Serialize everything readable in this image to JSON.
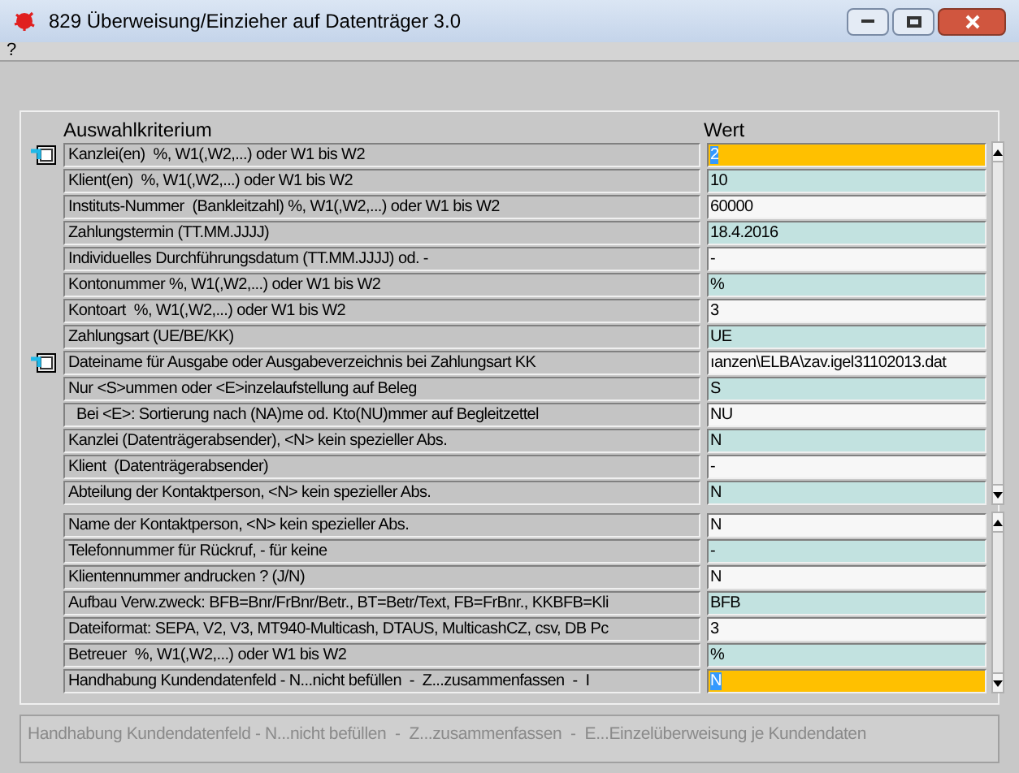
{
  "window": {
    "title": "829 Überweisung/Einzieher auf Datenträger 3.0"
  },
  "menu": [
    "?"
  ],
  "columns": [
    "Auswahlkriterium",
    "Wert"
  ],
  "sections": [
    {
      "rows": [
        {
          "label": "Kanzlei(en)  %, W1(,W2,...) oder W1 bis W2",
          "value": "2",
          "lookup": true,
          "focused": true
        },
        {
          "label": "Klient(en)  %, W1(,W2,...) oder W1 bis W2",
          "value": "10",
          "lookup": false,
          "focused": false
        },
        {
          "label": "Instituts-Nummer  (Bankleitzahl) %, W1(,W2,...) oder W1 bis W2",
          "value": "60000",
          "lookup": false,
          "focused": false
        },
        {
          "label": "Zahlungstermin (TT.MM.JJJJ)",
          "value": "18.4.2016",
          "lookup": false,
          "focused": false
        },
        {
          "label": "Individuelles Durchführungsdatum (TT.MM.JJJJ) od. -",
          "value": "-",
          "lookup": false,
          "focused": false
        },
        {
          "label": "Kontonummer %, W1(,W2,...) oder W1 bis W2",
          "value": "%",
          "lookup": false,
          "focused": false
        },
        {
          "label": "Kontoart  %, W1(,W2,...) oder W1 bis W2",
          "value": "3",
          "lookup": false,
          "focused": false
        },
        {
          "label": "Zahlungsart (UE/BE/KK)",
          "value": "UE",
          "lookup": false,
          "focused": false
        },
        {
          "label": "Dateiname für Ausgabe oder Ausgabeverzeichnis bei Zahlungsart KK",
          "value": "ıanzen\\ELBA\\zav.igel31102013.dat",
          "lookup": true,
          "focused": false
        },
        {
          "label": "Nur <S>ummen oder <E>inzelaufstellung auf Beleg",
          "value": "S",
          "lookup": false,
          "focused": false
        },
        {
          "label": "  Bei <E>: Sortierung nach (NA)me od. Kto(NU)mmer auf Begleitzettel",
          "value": "NU",
          "lookup": false,
          "focused": false
        },
        {
          "label": "Kanzlei (Datenträgerabsender), <N> kein spezieller Abs.",
          "value": "N",
          "lookup": false,
          "focused": false
        },
        {
          "label": "Klient  (Datenträgerabsender)",
          "value": "-",
          "lookup": false,
          "focused": false
        },
        {
          "label": "Abteilung der Kontaktperson, <N> kein spezieller Abs.",
          "value": "N",
          "lookup": false,
          "focused": false
        }
      ]
    },
    {
      "rows": [
        {
          "label": "Name der Kontaktperson, <N> kein spezieller Abs.",
          "value": "N",
          "lookup": false,
          "focused": false
        },
        {
          "label": "Telefonnummer für Rückruf, - für keine",
          "value": "-",
          "lookup": false,
          "focused": false
        },
        {
          "label": "Klientennummer andrucken ? (J/N)",
          "value": "N",
          "lookup": false,
          "focused": false
        },
        {
          "label": "Aufbau Verw.zweck: BFB=Bnr/FrBnr/Betr., BT=Betr/Text, FB=FrBnr., KKBFB=Kli",
          "value": "BFB",
          "lookup": false,
          "focused": false
        },
        {
          "label": "Dateiformat: SEPA, V2, V3, MT940-Multicash, DTAUS, MulticashCZ, csv, DB Pc",
          "value": "3",
          "lookup": false,
          "focused": false
        },
        {
          "label": "Betreuer  %, W1(,W2,...) oder W1 bis W2",
          "value": "%",
          "lookup": false,
          "focused": false
        },
        {
          "label": "Handhabung Kundendatenfeld - N...nicht befüllen  -  Z...zusammenfassen  -  I",
          "value": "N",
          "lookup": false,
          "focused": true
        }
      ]
    }
  ],
  "status": "Handhabung Kundendatenfeld - N...nicht befüllen  -  Z...zusammenfassen  -  E...Einzelüberweisung je Kundendaten"
}
